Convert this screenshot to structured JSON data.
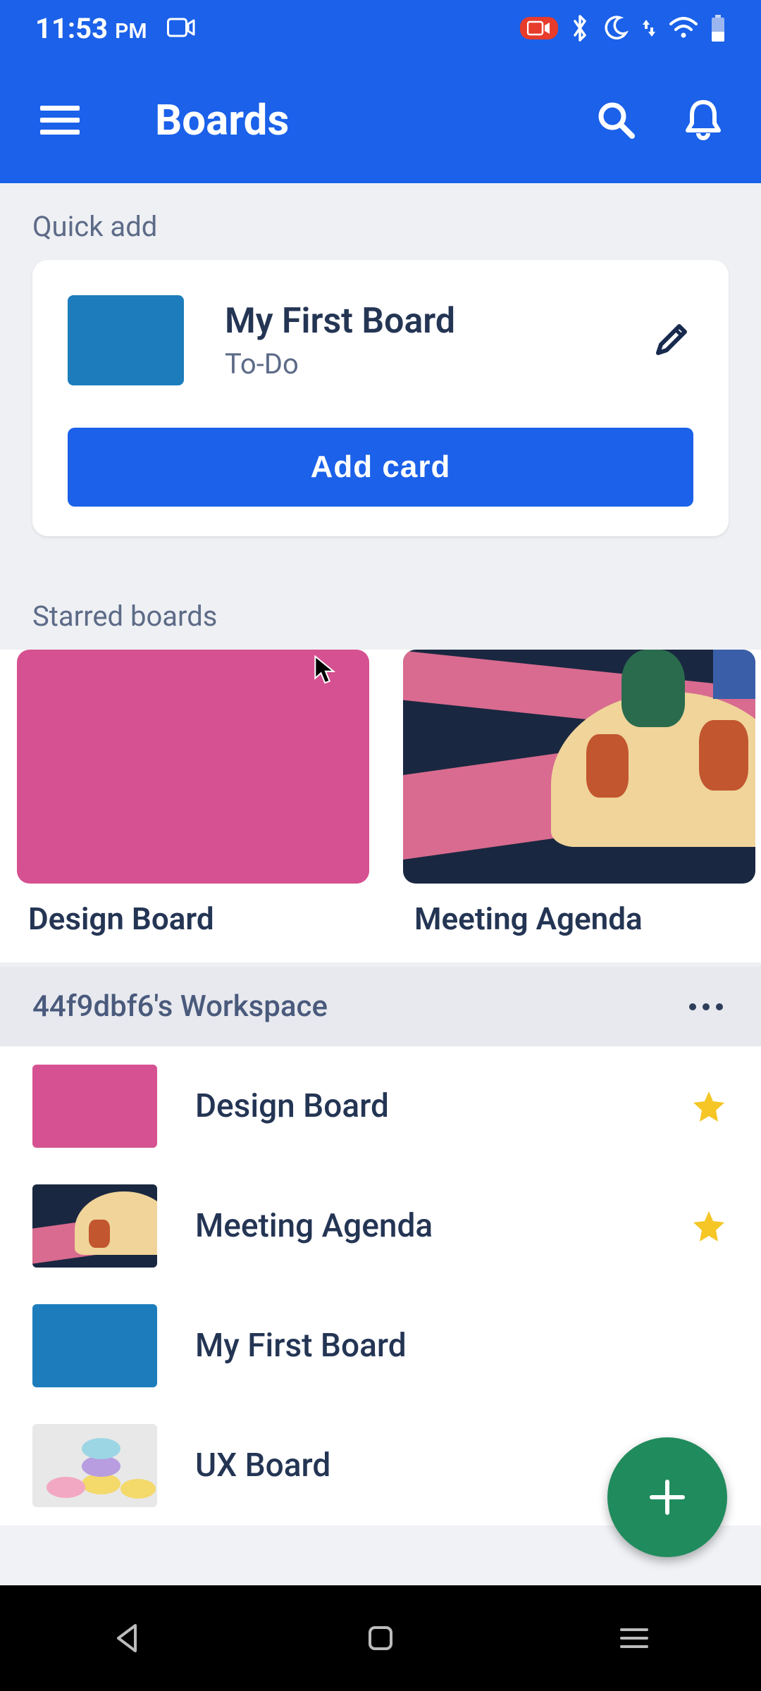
{
  "status": {
    "time": "11:53",
    "period": "PM"
  },
  "appbar": {
    "title": "Boards"
  },
  "quick_add": {
    "heading": "Quick add",
    "board_title": "My First Board",
    "list_name": "To-Do",
    "button_label": "Add card",
    "thumb_color": "#1d7dbc"
  },
  "starred": {
    "heading": "Starred boards",
    "boards": [
      {
        "name": "Design Board",
        "cover": "pink"
      },
      {
        "name": "Meeting Agenda",
        "cover": "illustration"
      }
    ]
  },
  "workspace": {
    "name": "44f9dbf6's Workspace",
    "boards": [
      {
        "name": "Design Board",
        "thumb": "pink",
        "starred": true
      },
      {
        "name": "Meeting Agenda",
        "thumb": "illustration",
        "starred": true
      },
      {
        "name": "My First Board",
        "thumb": "blue",
        "starred": false
      },
      {
        "name": "UX Board",
        "thumb": "macaron",
        "starred": false
      }
    ]
  },
  "colors": {
    "primary": "#1b61e9",
    "fab": "#208b5d",
    "star": "#f5c626",
    "pink": "#d65191",
    "blue_board": "#1d7dbc"
  },
  "icons": {
    "menu": "menu",
    "search": "search",
    "bell": "notifications",
    "pencil": "edit",
    "more": "more-horizontal",
    "plus": "plus",
    "back": "nav-back",
    "home": "nav-home",
    "recents": "nav-recents"
  }
}
